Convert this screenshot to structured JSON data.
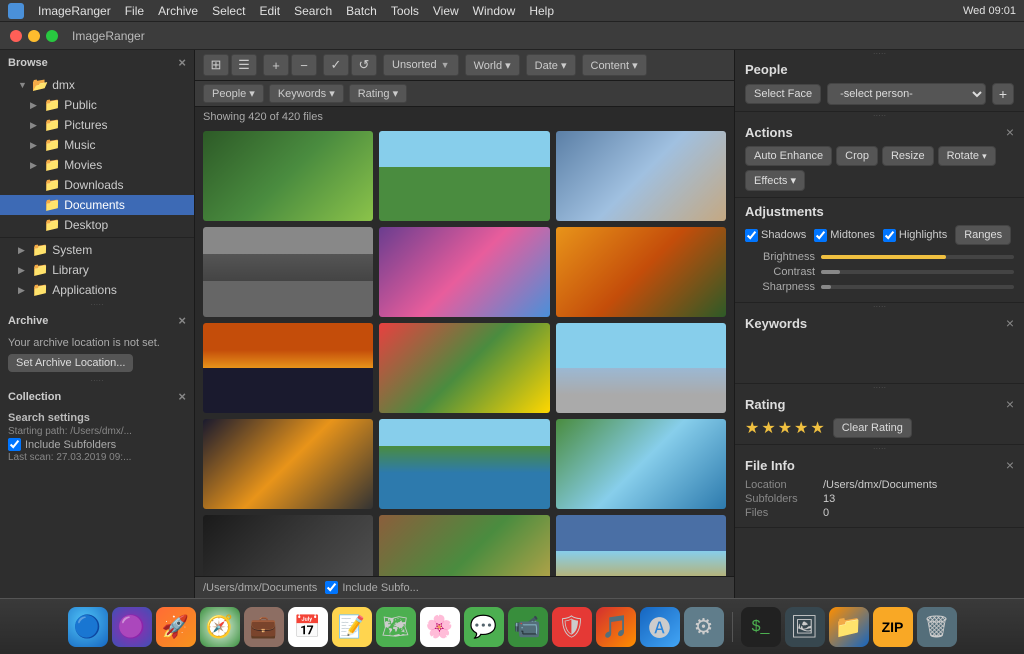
{
  "menubar": {
    "app_icon": "IR",
    "app_name": "ImageRanger",
    "menus": [
      "File",
      "Archive",
      "Select",
      "Edit",
      "Search",
      "Batch",
      "Tools",
      "View",
      "Window",
      "Help"
    ],
    "time": "Wed 09:01",
    "right_icons": [
      "wifi",
      "battery",
      "user",
      "search",
      "notification"
    ]
  },
  "titlebar": {
    "app_name": "ImageRanger"
  },
  "sidebar": {
    "browse_label": "Browse",
    "tree": [
      {
        "label": "dmx",
        "level": 0,
        "expanded": true,
        "has_arrow": true
      },
      {
        "label": "Public",
        "level": 1,
        "expanded": false,
        "has_arrow": true
      },
      {
        "label": "Pictures",
        "level": 1,
        "expanded": false,
        "has_arrow": true
      },
      {
        "label": "Music",
        "level": 1,
        "expanded": false,
        "has_arrow": true
      },
      {
        "label": "Movies",
        "level": 1,
        "expanded": false,
        "has_arrow": true
      },
      {
        "label": "Downloads",
        "level": 1,
        "expanded": false,
        "has_arrow": false
      },
      {
        "label": "Documents",
        "level": 1,
        "expanded": false,
        "selected": true,
        "has_arrow": false
      },
      {
        "label": "Desktop",
        "level": 1,
        "expanded": false,
        "has_arrow": false
      }
    ],
    "system_items": [
      {
        "label": "System"
      },
      {
        "label": "Library"
      },
      {
        "label": "Applications"
      }
    ],
    "archive_label": "Archive",
    "archive_message": "Your archive location is not set.",
    "archive_btn": "Set Archive Location...",
    "collection_label": "Collection",
    "search_settings_label": "Search settings",
    "starting_path": "Starting path: /Users/dmx/...",
    "include_subfolders": "Include Subfolders",
    "last_scan": "Last scan: 27.03.2019 09:..."
  },
  "toolbar": {
    "view_grid": "⊞",
    "view_list": "☰",
    "zoom_in": "+",
    "zoom_out": "−",
    "check": "✓",
    "refresh": "↺",
    "sort_label": "Unsorted",
    "world_label": "World ▾",
    "date_label": "Date ▾",
    "content_label": "Content ▾"
  },
  "filterbar": {
    "people_btn": "People ▾",
    "keywords_btn": "Keywords ▾",
    "rating_btn": "Rating ▾"
  },
  "content": {
    "file_count": "Showing 420 of 420 files",
    "bottom_path": "/Users/dmx/Documents",
    "include_subfolders": "Include Subfo..."
  },
  "photos": [
    {
      "id": 1,
      "color_class": "img-green"
    },
    {
      "id": 2,
      "color_class": "img-field"
    },
    {
      "id": 3,
      "color_class": "img-girl"
    },
    {
      "id": 4,
      "color_class": "img-castle"
    },
    {
      "id": 5,
      "color_class": "img-fantasy"
    },
    {
      "id": 6,
      "color_class": "img-autumn"
    },
    {
      "id": 7,
      "color_class": "img-sunset"
    },
    {
      "id": 8,
      "color_class": "img-food"
    },
    {
      "id": 9,
      "color_class": "img-mountain"
    },
    {
      "id": 10,
      "color_class": "img-bike"
    },
    {
      "id": 11,
      "color_class": "img-lake"
    },
    {
      "id": 12,
      "color_class": "img-landscape"
    },
    {
      "id": 13,
      "color_class": "img-dark"
    },
    {
      "id": 14,
      "color_class": "img-dog"
    },
    {
      "id": 15,
      "color_class": "img-sky"
    }
  ],
  "right_panel": {
    "people_title": "People",
    "select_face_btn": "Select Face",
    "person_placeholder": "-select person-",
    "add_person_btn": "+",
    "actions_title": "Actions",
    "action_buttons": [
      "Auto Enhance",
      "Crop",
      "Resize",
      "Rotate ▾",
      "Effects ▾"
    ],
    "adjustments_title": "Adjustments",
    "shadows_label": "Shadows",
    "midtones_label": "Midtones",
    "highlights_label": "Highlights",
    "ranges_btn": "Ranges",
    "brightness_label": "Brightness",
    "contrast_label": "Contrast",
    "sharpness_label": "Sharpness",
    "brightness_pct": 65,
    "contrast_pct": 10,
    "sharpness_pct": 5,
    "keywords_title": "Keywords",
    "rating_title": "Rating",
    "stars": 5,
    "clear_rating_btn": "Clear Rating",
    "file_info_title": "File Info",
    "location_label": "Location",
    "location_value": "/Users/dmx/Documents",
    "subfolders_label": "Subfolders",
    "subfolders_value": "13",
    "files_label": "Files",
    "files_value": "0"
  },
  "dock": {
    "items": [
      {
        "name": "finder",
        "icon": "🔵",
        "label": "Finder"
      },
      {
        "name": "siri",
        "icon": "🟣",
        "label": "Siri"
      },
      {
        "name": "launchpad",
        "icon": "🚀",
        "label": "Launchpad"
      },
      {
        "name": "safari",
        "icon": "🧭",
        "label": "Safari"
      },
      {
        "name": "briefcase",
        "icon": "💼",
        "label": "Briefcase"
      },
      {
        "name": "calendar",
        "icon": "📅",
        "label": "Calendar"
      },
      {
        "name": "notes",
        "icon": "📝",
        "label": "Notes"
      },
      {
        "name": "maps",
        "icon": "🗺",
        "label": "Maps"
      },
      {
        "name": "photos",
        "icon": "🖼",
        "label": "Photos"
      },
      {
        "name": "messages",
        "icon": "💬",
        "label": "Messages"
      },
      {
        "name": "facetime",
        "icon": "📹",
        "label": "FaceTime"
      },
      {
        "name": "vpn",
        "icon": "🛡",
        "label": "VPN"
      },
      {
        "name": "music",
        "icon": "🎵",
        "label": "Music"
      },
      {
        "name": "appstore",
        "icon": "🅐",
        "label": "App Store"
      },
      {
        "name": "prefs",
        "icon": "⚙",
        "label": "Preferences"
      },
      {
        "name": "terminal",
        "icon": "💻",
        "label": "Terminal"
      },
      {
        "name": "imageviewer",
        "icon": "🖼",
        "label": "Image Viewer"
      },
      {
        "name": "files",
        "icon": "📁",
        "label": "Files"
      },
      {
        "name": "zip",
        "icon": "📦",
        "label": "Zip"
      },
      {
        "name": "trash",
        "icon": "🗑",
        "label": "Trash"
      }
    ]
  }
}
